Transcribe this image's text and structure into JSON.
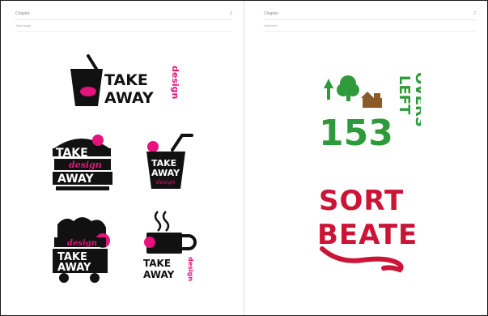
{
  "left_page": {
    "header_title": "Chapter",
    "header_number": "2",
    "subheader": "Take Away",
    "logos": {
      "main": {
        "line1": "TAKE",
        "line2": "AWAY",
        "script": "design"
      },
      "burger": {
        "line1": "TAKE",
        "script": "design",
        "line2": "AWAY"
      },
      "cup": {
        "line1": "TAKE",
        "line2": "AWAY",
        "script": "design"
      },
      "fries": {
        "script": "design",
        "line1": "TAKE",
        "line2": "AWAY"
      },
      "mug": {
        "line1": "TAKE",
        "line2": "AWAY",
        "script": "design"
      }
    }
  },
  "right_page": {
    "header_title": "Chapter",
    "header_number": "2",
    "subheader": "Leftovers",
    "logos": {
      "leftovers": {
        "number": "153",
        "line1": "LEFT",
        "line2": "OVERS"
      },
      "sort_beate": {
        "line1": "SORT",
        "line2": "BEATE"
      }
    }
  },
  "colors": {
    "pink": "#e6127e",
    "green": "#2e9a3b",
    "red": "#cc1437",
    "brown": "#8a5a2b",
    "black": "#111111"
  }
}
